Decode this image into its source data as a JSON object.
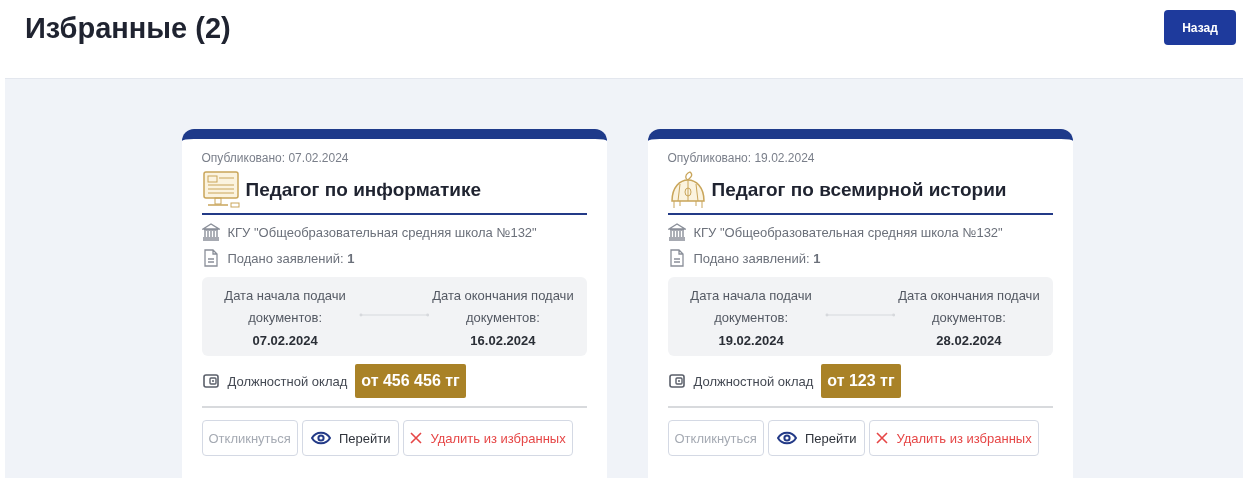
{
  "header": {
    "title": "Избранные (2)",
    "back_button": "Назад"
  },
  "cards": [
    {
      "published": "Опубликовано: 07.02.2024",
      "kind": "computer",
      "title": "Педагог по информатике",
      "organization": "КГУ \"Общеобразовательная средняя школа №132\"",
      "applications": "Подано заявлений: **1**",
      "start_label": "Дата начала подачи документов:",
      "start_date": "07.02.2024",
      "end_label": "Дата окончания подачи документов:",
      "end_date": "16.02.2024",
      "salary_label": "Должностной оклад",
      "salary": "от 456 456 тг",
      "buttons": {
        "respond": {
          "label": "Откликнуться",
          "disabled": true
        },
        "open": "Перейти",
        "remove": "Удалить из избранных"
      }
    },
    {
      "published": "Опубликовано: 19.02.2024",
      "kind": "helmet",
      "title": "Педагог по всемирной истории",
      "organization": "КГУ \"Общеобразовательная средняя школа №132\"",
      "applications": "Подано заявлений: **1**",
      "start_label": "Дата начала подачи документов:",
      "start_date": "19.02.2024",
      "end_label": "Дата окончания подачи документов:",
      "end_date": "28.02.2024",
      "salary_label": "Должностной оклад",
      "salary": "от 123 тг",
      "buttons": {
        "respond": {
          "label": "Откликнуться",
          "disabled": true
        },
        "open": "Перейти",
        "remove": "Удалить из избранных"
      }
    }
  ]
}
